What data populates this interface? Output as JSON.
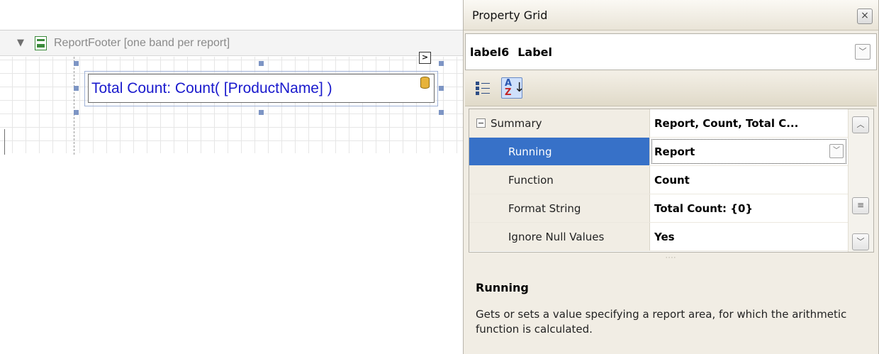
{
  "designer": {
    "band": {
      "title": "ReportFooter [one band per report]",
      "expand_icon": "triangle-down-icon",
      "band_icon": "report-footer-band-icon"
    },
    "label_control": {
      "text": "Total Count: Count( [ProductName] )",
      "text_color": "#1a1acd"
    },
    "smart_tag_glyph": "&gt;",
    "smart_tag_icon": "smart-tag-icon",
    "binding_icon": "database-icon"
  },
  "property_grid": {
    "title": "Property Grid",
    "close_glyph": "×",
    "object": {
      "name": "label6",
      "type": "Label"
    },
    "toolbar": {
      "categorized_icon": "categorized-icon",
      "alphabetical_icon": "sort-alphabetical-icon"
    },
    "rows": [
      {
        "name": "Summary",
        "value": "Report, Count, Total C...",
        "category": true
      },
      {
        "name": "Running",
        "value": "Report",
        "selected": true,
        "has_dropdown": true
      },
      {
        "name": "Function",
        "value": "Count"
      },
      {
        "name": "Format String",
        "value": "Total Count: {0}"
      },
      {
        "name": "Ignore Null Values",
        "value": "Yes"
      }
    ],
    "description": {
      "title": "Running",
      "text": "Gets or sets a value specifying a report area, for which the arithmetic function is calculated."
    },
    "colors": {
      "selection": "#3771c8",
      "panel_bg": "#f1ede4"
    }
  }
}
